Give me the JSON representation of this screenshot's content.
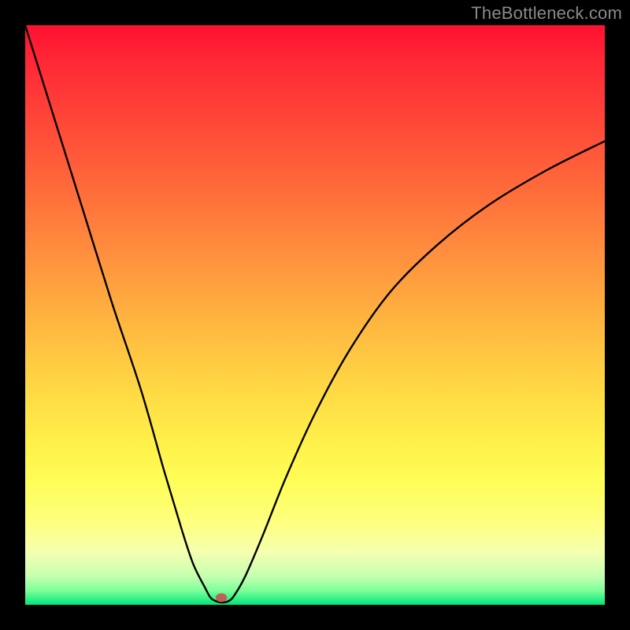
{
  "watermark": "TheBottleneck.com",
  "chart_data": {
    "type": "line",
    "title": "",
    "xlabel": "",
    "ylabel": "",
    "xlim": [
      0,
      100
    ],
    "ylim": [
      0,
      100
    ],
    "grid": false,
    "series": [
      {
        "name": "bottleneck-curve",
        "x": [
          0,
          5,
          10,
          15,
          20,
          24,
          27,
          29,
          31,
          32,
          33,
          34,
          35,
          36,
          38,
          41,
          45,
          50,
          56,
          63,
          71,
          80,
          90,
          100
        ],
        "values": [
          100,
          84,
          68,
          52,
          37,
          23,
          13,
          7,
          3,
          1.2,
          0.6,
          0.4,
          0.6,
          1.5,
          5,
          12,
          22,
          33,
          44,
          54,
          62,
          69,
          75,
          80
        ]
      }
    ],
    "marker": {
      "x": 33.8,
      "y_from_bottom_pct": 1.2
    },
    "gradient_stops": [
      {
        "pct": 0,
        "color": "#ff1030"
      },
      {
        "pct": 6,
        "color": "#ff2736"
      },
      {
        "pct": 15,
        "color": "#ff4238"
      },
      {
        "pct": 28,
        "color": "#ff6a3a"
      },
      {
        "pct": 40,
        "color": "#ff913e"
      },
      {
        "pct": 52,
        "color": "#ffb840"
      },
      {
        "pct": 63,
        "color": "#ffd944"
      },
      {
        "pct": 72,
        "color": "#fff04a"
      },
      {
        "pct": 79,
        "color": "#fffe58"
      },
      {
        "pct": 86,
        "color": "#feff80"
      },
      {
        "pct": 91,
        "color": "#f5ffb0"
      },
      {
        "pct": 95,
        "color": "#c6ffb0"
      },
      {
        "pct": 97.5,
        "color": "#7fff9a"
      },
      {
        "pct": 100,
        "color": "#00e67a"
      }
    ]
  }
}
